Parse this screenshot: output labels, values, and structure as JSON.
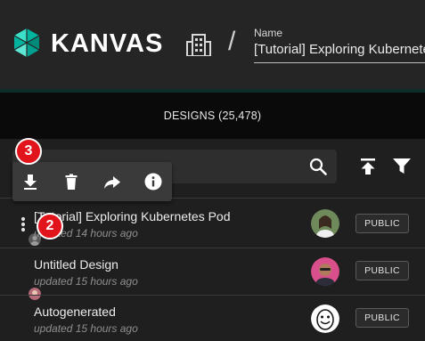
{
  "header": {
    "logo_text": "KANVAS",
    "logo_icon": "kanvas-hex-logo-icon",
    "workspace_icon": "building-icon",
    "separator": "/",
    "name_label": "Name",
    "name_value": "[Tutorial] Exploring Kubernetes Pod",
    "accent_color": "#00b39f"
  },
  "designs_bar": {
    "label": "DESIGNS (25,478)"
  },
  "search": {
    "placeholder": "",
    "icon": "search-icon"
  },
  "actions": {
    "upload_icon": "upload-icon",
    "filter_icon": "filter-icon"
  },
  "toolbar": {
    "icons": [
      "download-icon",
      "delete-icon",
      "share-icon",
      "info-icon"
    ]
  },
  "badges": {
    "step3": "3",
    "step2": "2",
    "color": "#e2141b"
  },
  "designs": [
    {
      "title": "[Tutorial] Exploring Kubernetes Pod",
      "updated": "updated 14 hours ago",
      "visibility": "PUBLIC"
    },
    {
      "title": "Untitled Design",
      "updated": "updated 15 hours ago",
      "visibility": "PUBLIC"
    },
    {
      "title": "Autogenerated",
      "updated": "updated 15 hours ago",
      "visibility": "PUBLIC"
    }
  ]
}
